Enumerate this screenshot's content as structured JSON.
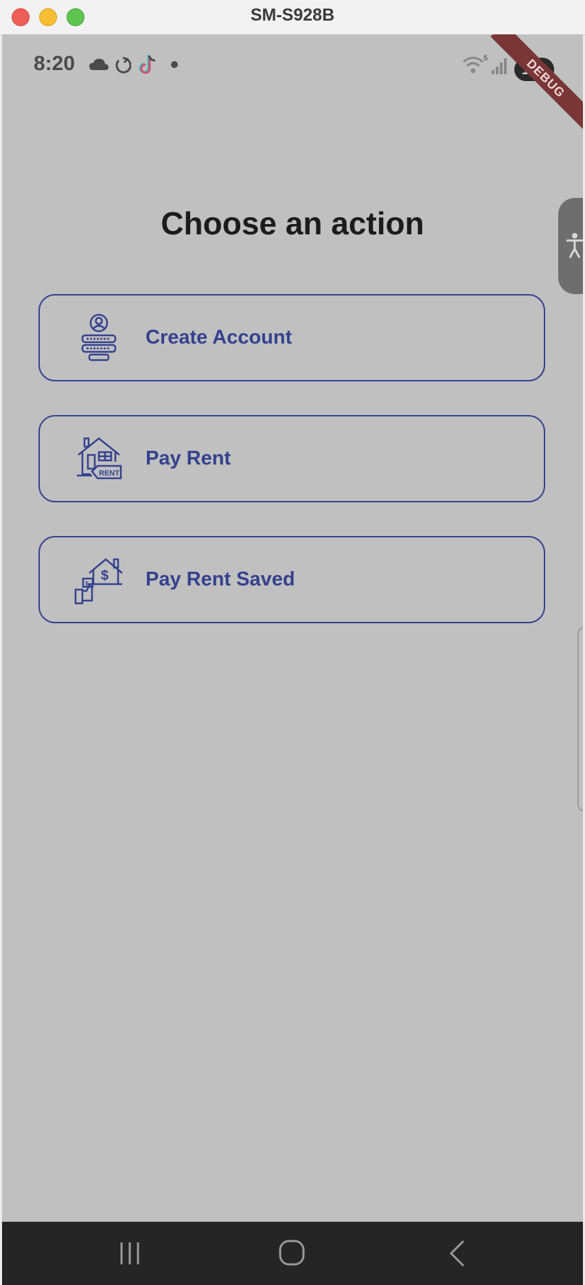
{
  "window": {
    "title": "SM-S928B"
  },
  "statusbar": {
    "time": "8:20",
    "battery": "100",
    "icons": [
      "cloud-icon",
      "sync-icon",
      "tiktok-icon",
      "dot-icon",
      "wifi-icon",
      "signal-icon",
      "battery-icon"
    ]
  },
  "debug_banner": "DEBUG",
  "main": {
    "heading": "Choose an action",
    "actions": [
      {
        "label": "Create Account",
        "icon": "user-account-icon"
      },
      {
        "label": "Pay Rent",
        "icon": "house-rent-icon"
      },
      {
        "label": "Pay Rent Saved",
        "icon": "house-dollar-icon"
      }
    ]
  },
  "navbar": {
    "icons": [
      "recents-icon",
      "home-icon",
      "back-icon"
    ]
  },
  "colors": {
    "screen_background": "#c0c0c0",
    "accent": "#34418e",
    "heading": "#1c1c1c",
    "navbar": "#252525",
    "debug_ribbon": "#7a3535"
  }
}
